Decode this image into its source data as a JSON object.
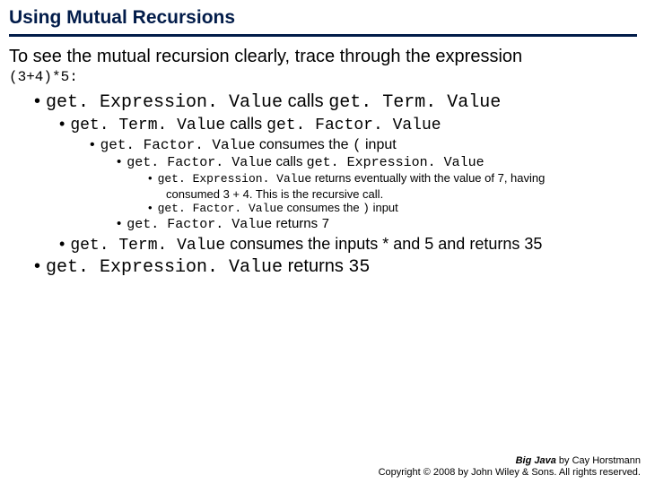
{
  "title": "Using Mutual Recursions",
  "intro": "To see the mutual recursion clearly, trace through the expression",
  "expression": "(3+4)*5:",
  "b0": {
    "code": "get. Expression. Value",
    "mid": " calls ",
    "code2": "get. Term. Value"
  },
  "b1": {
    "code": "get. Term. Value",
    "mid": " calls ",
    "code2": "get. Factor. Value"
  },
  "b2a": {
    "code": "get. Factor. Value",
    "mid": " consumes the ",
    "code2": "(",
    "tail": " input"
  },
  "b2b": {
    "code": "get. Factor. Value",
    "mid": " calls ",
    "code2": "get. Expression. Value"
  },
  "b3a": {
    "code": "get. Expression. Value",
    "tail": "  returns  eventually with the value of 7, having"
  },
  "b3a_cont": "consumed 3 + 4. This is the recursive call.",
  "b3b": {
    "code": "get. Factor. Value",
    "mid": "  consumes the  ",
    "code2": ")",
    "tail": "  input"
  },
  "b2c": {
    "code": "get. Factor. Value",
    "mid": " returns ",
    "code2": "7"
  },
  "b1b": {
    "code": "get. Term. Value",
    "tail": "  consumes the inputs * and 5 and returns 35"
  },
  "b0b": {
    "code": "get. Expression. Value",
    "mid": " returns ",
    "code2": "35"
  },
  "footer": {
    "book": "Big Java",
    "by": " by Cay Horstmann",
    "copyright": "Copyright © 2008 by John Wiley & Sons.  All rights reserved."
  }
}
